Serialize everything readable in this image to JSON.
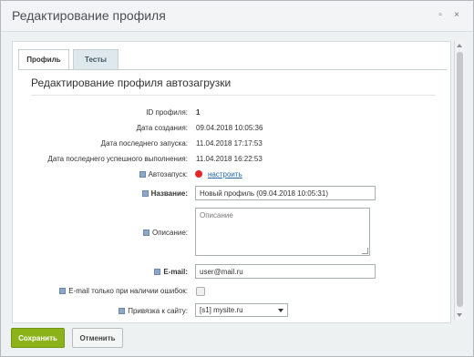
{
  "window": {
    "title": "Редактирование профиля",
    "minimize_glyph": "▫",
    "close_glyph": "×"
  },
  "tabs": [
    {
      "label": "Профиль",
      "active": true
    },
    {
      "label": "Тесты",
      "active": false
    }
  ],
  "section_title": "Редактирование профиля автозагрузки",
  "fields": {
    "id": {
      "label": "ID профиля:",
      "value": "1"
    },
    "created": {
      "label": "Дата создания:",
      "value": "09.04.2018 10:05:36"
    },
    "last_run": {
      "label": "Дата последнего запуска:",
      "value": "11.04.2018 17:17:53"
    },
    "last_success": {
      "label": "Дата последнего успешного выполнения:",
      "value": "11.04.2018 16:22:53"
    },
    "autorun": {
      "label": "Автозапуск:",
      "status_color": "#e2262a",
      "link": "настроить"
    },
    "name": {
      "label": "Название",
      "value": "Новый профиль (09.04.2018 10:05:31)"
    },
    "description": {
      "label": "Описание:",
      "placeholder": "Описание"
    },
    "email": {
      "label": "E-mail",
      "value": "user@mail.ru"
    },
    "email_errors_only": {
      "label": "E-mail только при наличии ошибок:",
      "checked": false
    },
    "site": {
      "label": "Привязка к сайту:",
      "value": "[s1] mysite.ru"
    }
  },
  "footer": {
    "save_label": "Сохранить",
    "cancel_label": "Отменить"
  },
  "colors": {
    "save_button": "#8bb319",
    "link": "#2067b0",
    "hint_icon": "#8ea7c6"
  }
}
